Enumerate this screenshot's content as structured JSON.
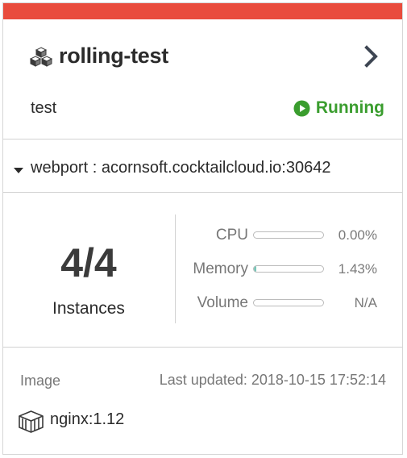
{
  "header": {
    "accent_color": "#e94c3d",
    "icon": "cubes-icon",
    "title": "rolling-test",
    "chevron_icon": "chevron-right-icon"
  },
  "subheader": {
    "namespace": "test",
    "status": "Running",
    "status_icon": "play-circle-icon",
    "status_color": "#3a9d2e"
  },
  "port": {
    "caret_icon": "caret-down-icon",
    "text": "webport : acornsoft.cocktailcloud.io:30642"
  },
  "stats": {
    "instances_count": "4/4",
    "instances_label": "Instances",
    "metrics": [
      {
        "label": "CPU",
        "value": "0.00%",
        "fill_percent": 0
      },
      {
        "label": "Memory",
        "value": "1.43%",
        "fill_percent": 1.43
      },
      {
        "label": "Volume",
        "value": "N/A",
        "fill_percent": 0
      }
    ]
  },
  "footer": {
    "image_label": "Image",
    "last_updated": "Last updated: 2018-10-15 17:52:14",
    "image_icon": "package-box-icon",
    "image_name": "nginx:1.12"
  }
}
